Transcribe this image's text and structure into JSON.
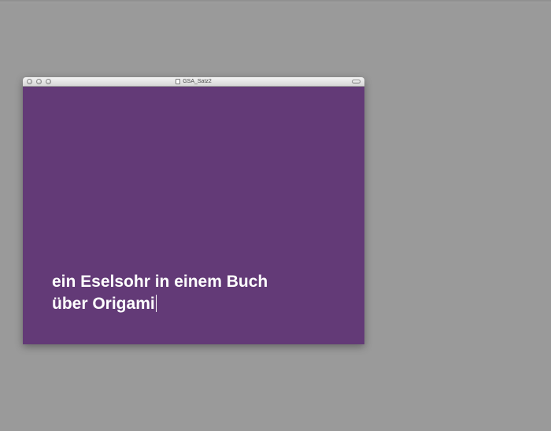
{
  "window": {
    "title": "GSA_Satz2"
  },
  "content": {
    "line1": "ein Eselsohr in einem Buch",
    "line2": "über Origami"
  },
  "colors": {
    "desktop": "#9a9a9a",
    "content_background": "#633a77",
    "text": "#ffffff"
  }
}
